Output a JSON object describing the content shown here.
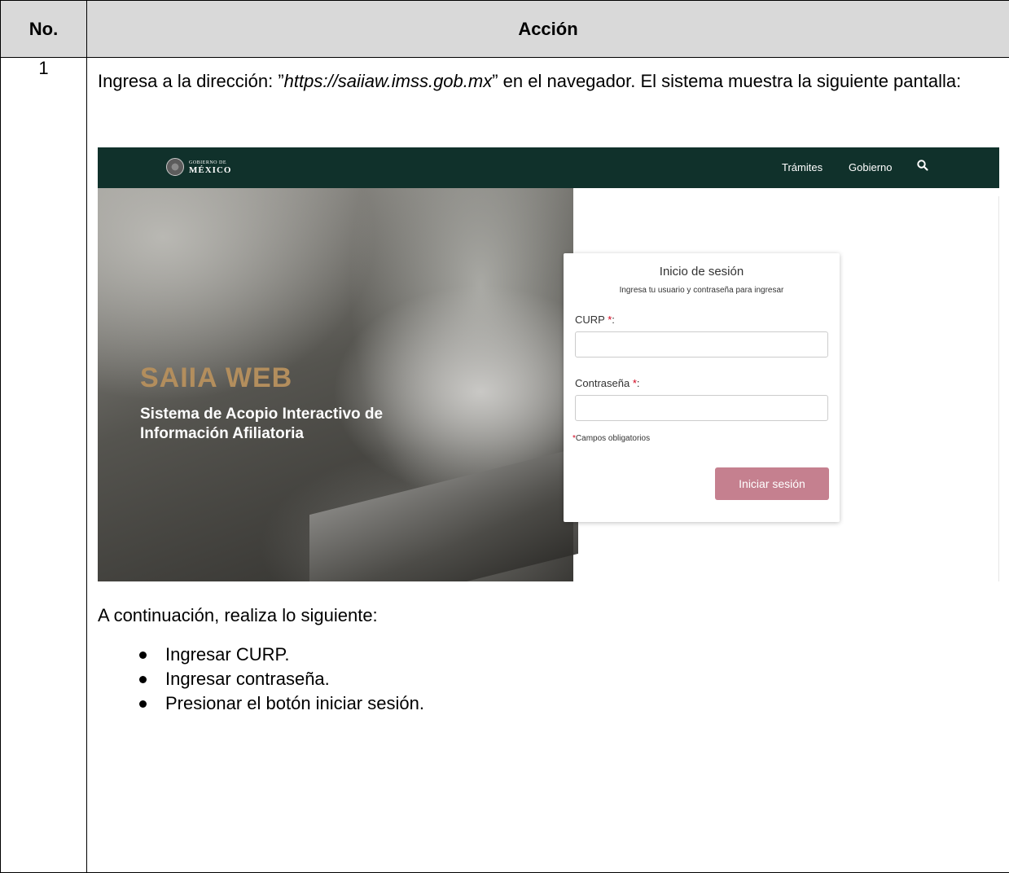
{
  "table": {
    "header_no": "No.",
    "header_accion": "Acción",
    "row_number": "1"
  },
  "intro": {
    "before_url": "Ingresa a la dirección: ”",
    "url": "https://saiiaw.imss.gob.mx",
    "after_url": "” en el navegador. El sistema muestra la siguiente pantalla:"
  },
  "screenshot": {
    "logo_small": "GOBIERNO DE",
    "logo_big": "MÉXICO",
    "nav_tramites": "Trámites",
    "nav_gobierno": "Gobierno",
    "search_icon": "search-icon",
    "hero_title": "SAIIA WEB",
    "hero_subtitle": "Sistema de Acopio Interactivo de Información Afiliatoria",
    "login_title": "Inicio de sesión",
    "login_subtitle": "Ingresa tu usuario y contraseña para ingresar",
    "curp_label": "CURP",
    "password_label": "Contraseña",
    "required_mark": "*",
    "colon": ":",
    "curp_value": "",
    "password_value": "",
    "required_note": "Campos obligatorios",
    "login_button": "Iniciar sesión",
    "colors": {
      "navbar": "#10312b",
      "accent_gold": "#b38e5d",
      "button": "#c5808f",
      "required": "#d0021b"
    }
  },
  "continue_text": "A continuación, realiza lo siguiente:",
  "steps": [
    "Ingresar CURP.",
    "Ingresar contraseña.",
    "Presionar el botón iniciar sesión."
  ]
}
